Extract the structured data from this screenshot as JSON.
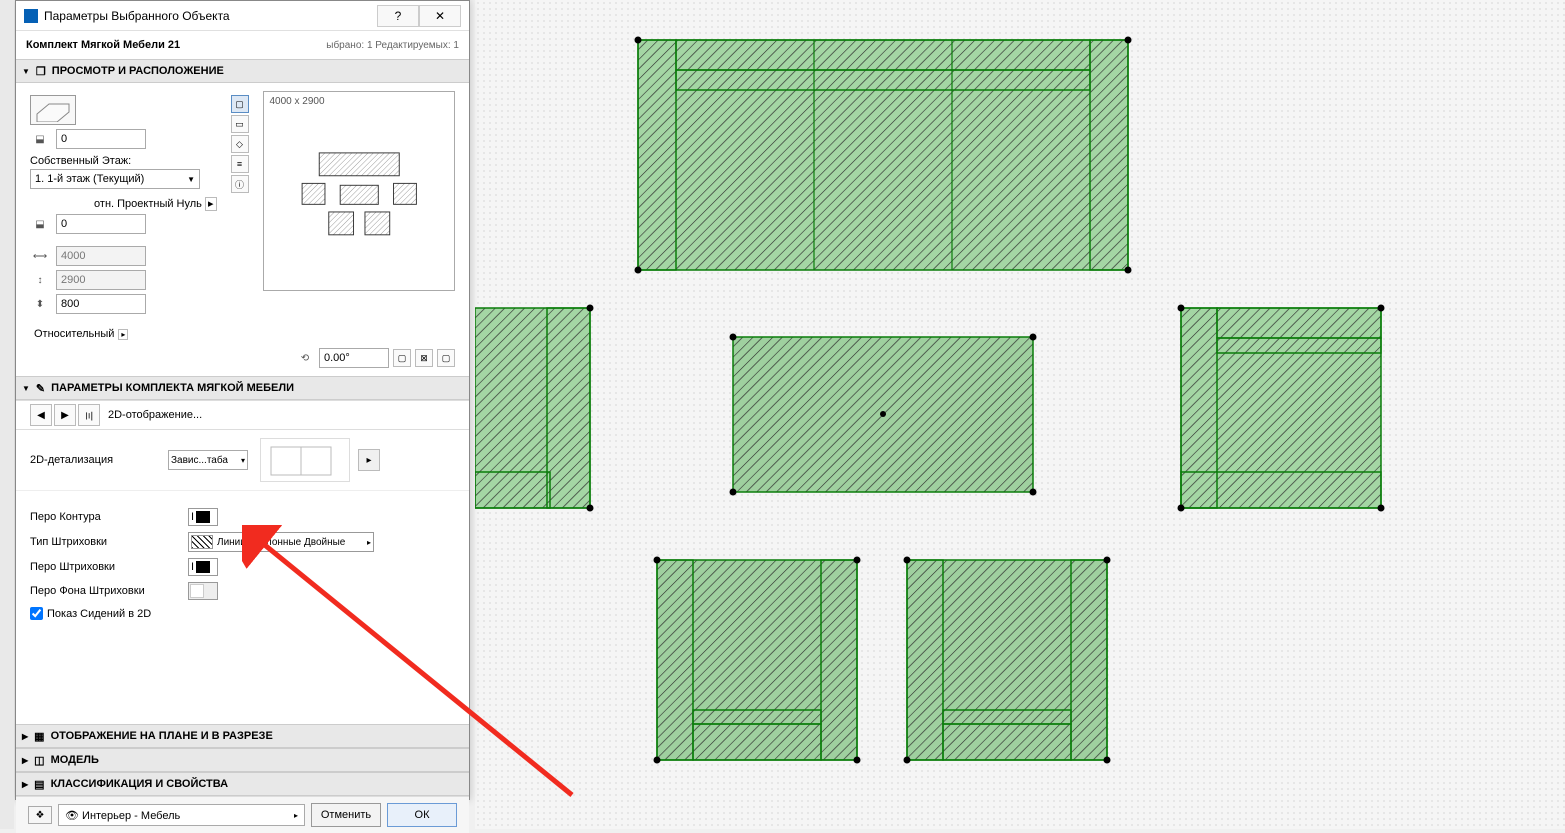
{
  "dialog": {
    "title": "Параметры Выбранного Объекта",
    "object_name": "Комплект Мягкой Мебели 21",
    "selection_info": "ыбрано: 1 Редактируемых: 1",
    "sections": {
      "preview": {
        "title": "ПРОСМОТР И РАСПОЛОЖЕНИЕ"
      },
      "params": {
        "title": "ПАРАМЕТРЫ КОМПЛЕКТА МЯГКОЙ МЕБЕЛИ"
      },
      "plan": {
        "title": "ОТОБРАЖЕНИЕ НА ПЛАНЕ И В РАЗРЕЗЕ"
      },
      "model": {
        "title": "МОДЕЛЬ"
      },
      "class": {
        "title": "КЛАССИФИКАЦИЯ И СВОЙСТВА"
      }
    },
    "preview_dims": "4000 x 2900",
    "floor_label": "Собственный Этаж:",
    "floor_value": "1. 1-й этаж (Текущий)",
    "proj_zero_label": "отн. Проектный Нуль",
    "elevation_top": "0",
    "elevation_bottom": "0",
    "dim_x": "4000",
    "dim_y": "2900",
    "dim_z": "800",
    "rotation_label": "Относительный",
    "rotation_value": "0.00°",
    "nav_label": "2D-отображение...",
    "detail_label": "2D-детализация",
    "detail_value": "Завис...таба",
    "contour_pen_label": "Перо Контура",
    "hatch_type_label": "Тип Штриховки",
    "hatch_type_value": "Линии Наклонные Двойные",
    "hatch_pen_label": "Перо Штриховки",
    "hatch_bg_pen_label": "Перо Фона Штриховки",
    "show_seats_label": "Показ Сидений в 2D",
    "layer_value": "Интерьер - Мебель",
    "cancel_btn": "Отменить",
    "ok_btn": "ОК"
  }
}
